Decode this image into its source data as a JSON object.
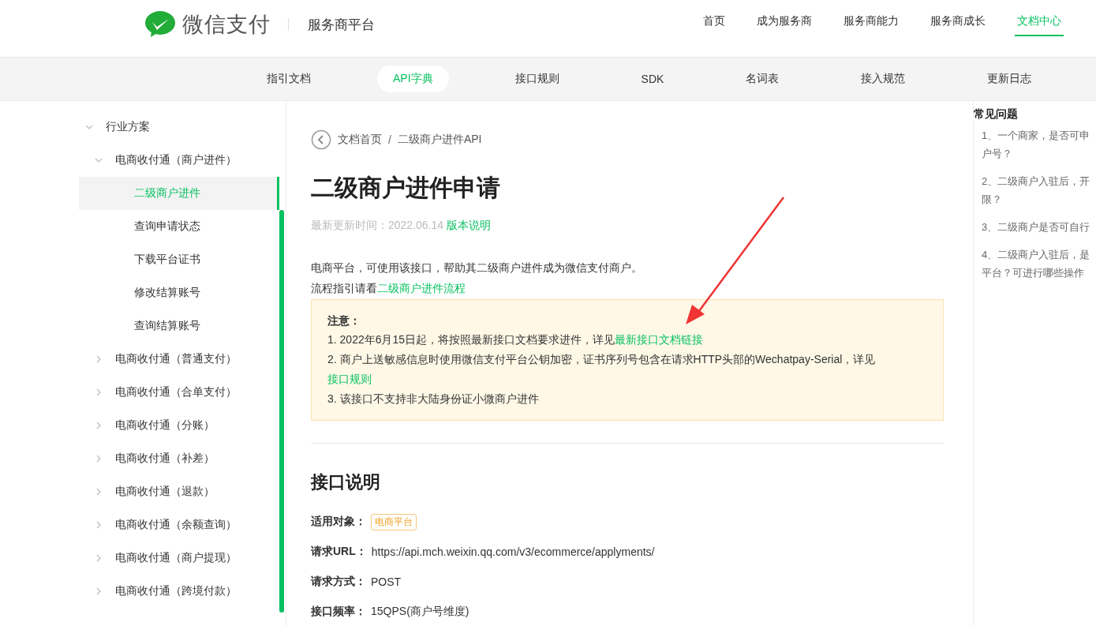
{
  "header": {
    "brand": "微信支付",
    "platform": "服务商平台",
    "nav": [
      {
        "label": "首页",
        "selected": false
      },
      {
        "label": "成为服务商",
        "selected": false
      },
      {
        "label": "服务商能力",
        "selected": false
      },
      {
        "label": "服务商成长",
        "selected": false
      },
      {
        "label": "文档中心",
        "selected": true
      }
    ]
  },
  "subnav": [
    {
      "label": "指引文档",
      "selected": false
    },
    {
      "label": "API字典",
      "selected": true
    },
    {
      "label": "接口规则",
      "selected": false
    },
    {
      "label": "SDK",
      "selected": false
    },
    {
      "label": "名词表",
      "selected": false
    },
    {
      "label": "接入规范",
      "selected": false
    },
    {
      "label": "更新日志",
      "selected": false
    }
  ],
  "sidebar": {
    "items": [
      {
        "label": "行业方案",
        "expanded": true,
        "selected": false,
        "children": [
          {
            "label": "电商收付通（商户进件）",
            "expanded": true,
            "selected": false,
            "children": [
              {
                "label": "二级商户进件",
                "selected": true
              },
              {
                "label": "查询申请状态",
                "selected": false
              },
              {
                "label": "下载平台证书",
                "selected": false
              },
              {
                "label": "修改结算账号",
                "selected": false
              },
              {
                "label": "查询结算账号",
                "selected": false
              }
            ]
          },
          {
            "label": "电商收付通（普通支付）",
            "expanded": false,
            "selected": false
          },
          {
            "label": "电商收付通（合单支付）",
            "expanded": false,
            "selected": false
          },
          {
            "label": "电商收付通（分账）",
            "expanded": false,
            "selected": false
          },
          {
            "label": "电商收付通（补差）",
            "expanded": false,
            "selected": false
          },
          {
            "label": "电商收付通（退款）",
            "expanded": false,
            "selected": false
          },
          {
            "label": "电商收付通（余额查询）",
            "expanded": false,
            "selected": false
          },
          {
            "label": "电商收付通（商户提现）",
            "expanded": false,
            "selected": false
          },
          {
            "label": "电商收付通（跨境付款）",
            "expanded": false,
            "selected": false
          }
        ]
      }
    ]
  },
  "breadcrumb": [
    "文档首页",
    "/",
    "二级商户进件API"
  ],
  "title": "二级商户进件申请",
  "updated": {
    "label": "最新更新时间：2022.06.14",
    "link": "版本说明"
  },
  "intro": "电商平台，可使用该接口，帮助其二级商户进件成为微信支付商户。",
  "flow": {
    "text": "流程指引请看",
    "link": "二级商户进件流程"
  },
  "notice": {
    "heading": "注意：",
    "items": [
      {
        "text": "1. 2022年6月15日起，将按照最新接口文档要求进件，详见",
        "link": "最新接口文档链接"
      },
      {
        "text": "2. 商户上送敏感信息时使用微信支付平台公钥加密，证书序列号包含在请求HTTP头部的Wechatpay-Serial，详见",
        "link": "接口规则"
      },
      {
        "text": "3. 该接口不支持非大陆身份证小微商户进件"
      }
    ]
  },
  "section": {
    "heading": "接口说明",
    "fields": [
      {
        "kind": "tag",
        "label": "适用对象：",
        "value": "电商平台"
      },
      {
        "kind": "text",
        "label": "请求URL：",
        "value": "https://api.mch.weixin.qq.com/v3/ecommerce/applyments/"
      },
      {
        "kind": "text",
        "label": "请求方式：",
        "value": "POST"
      },
      {
        "kind": "text",
        "label": "接口频率：",
        "value": "15QPS(商户号维度)"
      }
    ]
  },
  "faq": {
    "heading": "常见问题",
    "items": [
      {
        "lines": [
          "1、一个商家，是否可申",
          "户号？"
        ]
      },
      {
        "lines": [
          "2、二级商户入驻后，开",
          "限？"
        ]
      },
      {
        "lines": [
          "3、二级商户是否可自行"
        ]
      },
      {
        "lines": [
          "4、二级商户入驻后，是",
          "平台？可进行哪些操作"
        ]
      }
    ]
  }
}
